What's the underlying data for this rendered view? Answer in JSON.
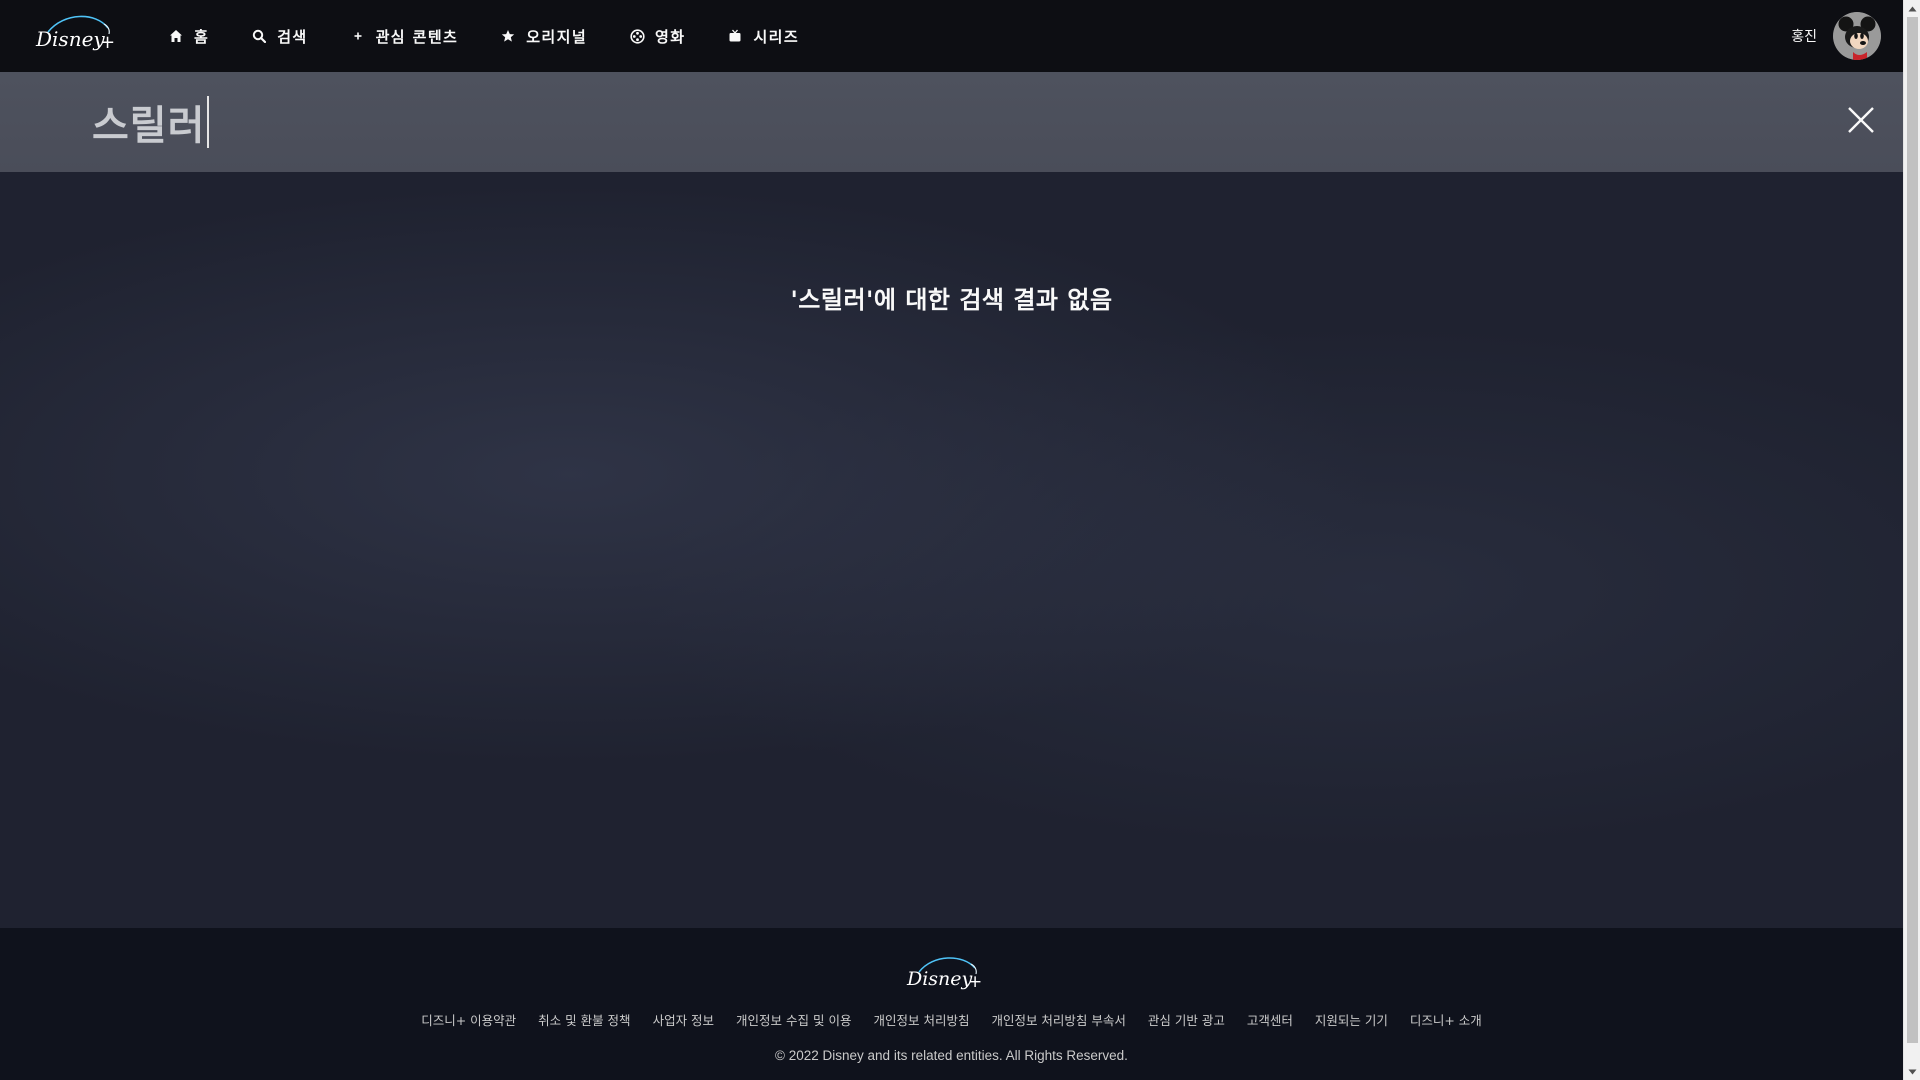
{
  "header": {
    "logo_alt": "Disney+",
    "nav": [
      {
        "label": "홈",
        "icon": "home-icon"
      },
      {
        "label": "검색",
        "icon": "search-icon"
      },
      {
        "label": "관심 콘텐츠",
        "icon": "plus-icon"
      },
      {
        "label": "오리지널",
        "icon": "star-icon"
      },
      {
        "label": "영화",
        "icon": "film-reel-icon"
      },
      {
        "label": "시리즈",
        "icon": "tv-icon"
      }
    ],
    "profile_name": "홍진"
  },
  "search": {
    "query": "스릴러"
  },
  "main": {
    "no_results_text": "'스릴러'에 대한 검색 결과 없음"
  },
  "footer": {
    "links": [
      "디즈니+ 이용약관",
      "취소 및 환불 정책",
      "사업자 정보",
      "개인정보 수집 및 이용",
      "개인정보 처리방침",
      "개인정보 처리방침 부속서",
      "관심 기반 광고",
      "고객센터",
      "지원되는 기기",
      "디즈니+ 소개"
    ],
    "copyright": "© 2022 Disney and its related entities. All Rights Reserved."
  },
  "colors": {
    "header_bg": "#0d0e13",
    "search_bar_bg": "#4b4e5a",
    "main_bg": "#1f2230",
    "footer_bg": "#0f121c",
    "text": "#f9f9f9"
  }
}
